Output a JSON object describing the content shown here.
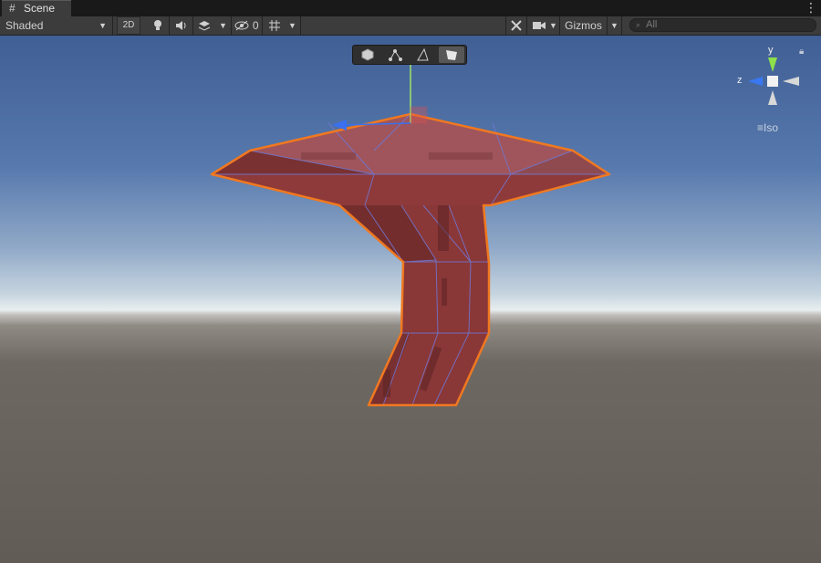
{
  "window": {
    "tab_label": "Scene",
    "tab_icon": "hash-icon",
    "menu_glyph": "⋮"
  },
  "toolbar": {
    "draw_mode": "Shaded",
    "btn_2d": "2D",
    "hidden_count": "0",
    "gizmos_label": "Gizmos",
    "search_placeholder": "All",
    "icons": [
      "lighting-icon",
      "audio-icon",
      "effects-icon",
      "visibility-icon",
      "grid-icon",
      "tools-icon",
      "camera-icon"
    ]
  },
  "palette": {
    "tools": [
      "object-mode-icon",
      "vertex-mode-icon",
      "edge-mode-icon",
      "face-mode-icon"
    ],
    "active_tool": "face-mode-icon"
  },
  "orientation_gizmo": {
    "y_label": "y",
    "z_label": "z",
    "projection_label": "Iso",
    "projection_glyph": "≡",
    "colors": {
      "y": "#8ee04a",
      "z": "#3a78f2",
      "x": "#d8d8d8"
    }
  },
  "scene": {
    "mesh_color": "#8d3a3a",
    "selection_outline": "#f07820",
    "wire_color": "#6e78d8"
  }
}
